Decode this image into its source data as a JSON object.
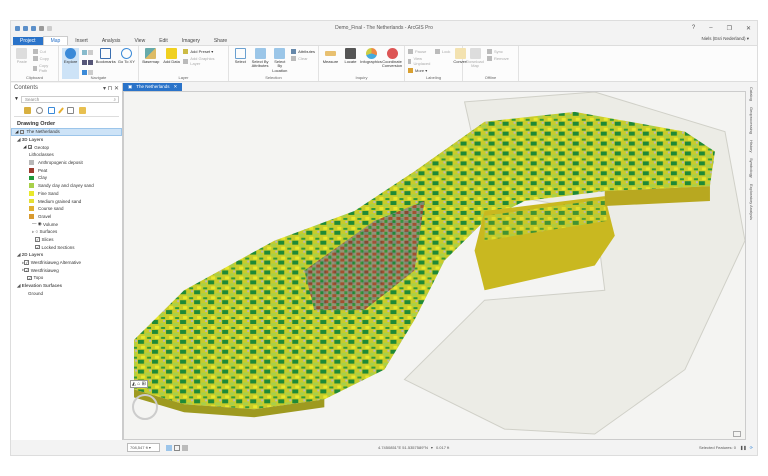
{
  "window": {
    "title": "Demo_Final - The Netherlands - ArcGIS Pro",
    "help": "?",
    "minimize": "–",
    "restore": "❐",
    "close": "✕"
  },
  "tabs": [
    "Project",
    "Map",
    "Insert",
    "Analysis",
    "View",
    "Edit",
    "Imagery",
    "Share"
  ],
  "user": "Niels (Esri Nederland) ▾",
  "ribbon": {
    "clipboard": {
      "label": "Clipboard",
      "paste": "Paste",
      "cut": "Cut",
      "copy": "Copy",
      "copy_path": "Copy Path"
    },
    "navigate": {
      "label": "Navigate",
      "explore": "Explore",
      "bookmarks": "Bookmarks",
      "goto": "Go To XY"
    },
    "layer": {
      "label": "Layer",
      "basemap": "Basemap",
      "add_data": "Add Data",
      "add_preset": "Add Preset ▾",
      "add_graphics": "Add Graphics Layer"
    },
    "selection": {
      "label": "Selection",
      "select": "Select",
      "by_attr": "Select By Attributes",
      "by_loc": "Select By Location",
      "attributes": "Attributes",
      "clear": "Clear"
    },
    "inquiry": {
      "label": "Inquiry",
      "measure": "Measure",
      "locate": "Locate",
      "infographics": "Infographics",
      "coord": "Coordinate Conversion"
    },
    "labeling": {
      "label": "Labeling",
      "pause": "Pause",
      "lock": "Lock",
      "view_unplaced": "View Unplaced",
      "more": "More ▾",
      "convert": "Convert"
    },
    "offline": {
      "label": "Offline",
      "download": "Download Map",
      "sync": "Sync",
      "remove": "Remove"
    }
  },
  "contents": {
    "title": "Contents",
    "search_placeholder": "Search",
    "drawing_order": "Drawing Order",
    "map_name": "The Netherlands",
    "layers3d": "3D Layers",
    "geotop": "Geotop",
    "lithoclasses": "Lithoclasses",
    "classes": [
      {
        "label": "Anthropogenic deposit",
        "color": "#b8b8b8"
      },
      {
        "label": "Peat",
        "color": "#9c3b2e"
      },
      {
        "label": "Clay",
        "color": "#1f9a3a"
      },
      {
        "label": "Sandy clay and clayey sand",
        "color": "#a8d04a"
      },
      {
        "label": "Fine Sand",
        "color": "#e8e82c"
      },
      {
        "label": "Medium grained sand",
        "color": "#e5e032"
      },
      {
        "label": "Course sand",
        "color": "#e0b030"
      },
      {
        "label": "Gravel",
        "color": "#d89a30"
      }
    ],
    "volume": "Volume",
    "surfaces": "Surfaces",
    "slices": "Slices",
    "locked": "Locked Sections",
    "layers2d": "2D Layers",
    "l2d": [
      "Westfrisiaweg Alternative",
      "Westfrisiaweg",
      "Topo"
    ],
    "elevation": "Elevation Surfaces",
    "ground": "Ground"
  },
  "map_tab": "The Netherlands",
  "side_tabs": [
    "Catalog",
    "Geoprocessing",
    "History",
    "Symbology",
    "Exploratory Analysis"
  ],
  "status": {
    "scale": "708,547 ft",
    "coords": "4.7450851°E 51.5357589°N",
    "elev": "0.017 ft",
    "selected": "Selected Features: 0"
  }
}
